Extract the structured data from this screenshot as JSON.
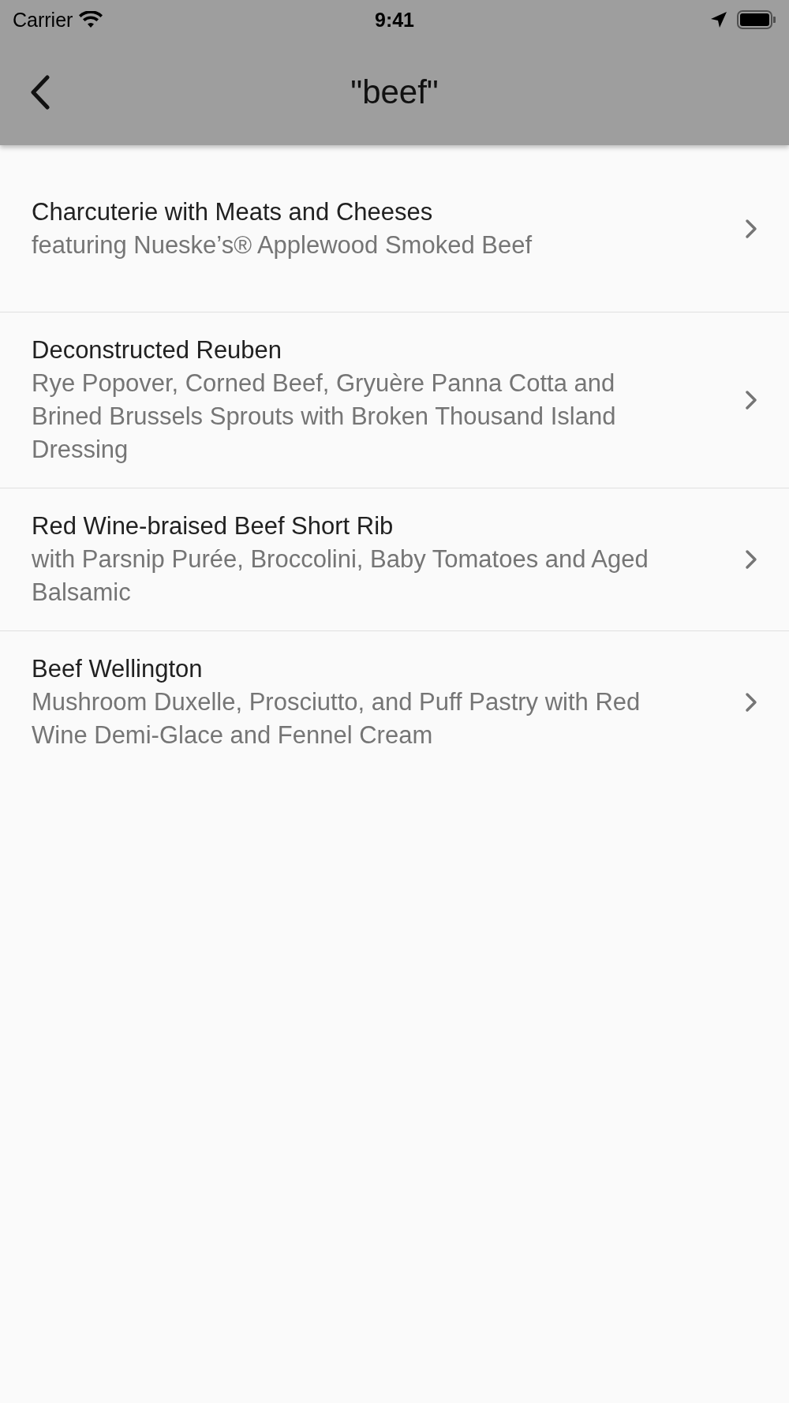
{
  "status_bar": {
    "carrier": "Carrier",
    "time": "9:41"
  },
  "nav_bar": {
    "title": "\"beef\""
  },
  "results": [
    {
      "title": "Charcuterie with Meats and Cheeses",
      "subtitle": "featuring Nueske’s® Applewood Smoked Beef"
    },
    {
      "title": "Deconstructed Reuben",
      "subtitle": "Rye Popover, Corned Beef, Gryuère Panna Cotta and Brined Brussels Sprouts with Broken Thousand Island Dressing"
    },
    {
      "title": "Red Wine-braised Beef Short Rib",
      "subtitle": "with Parsnip Purée, Broccolini, Baby Tomatoes and Aged Balsamic"
    },
    {
      "title": "Beef Wellington",
      "subtitle": "Mushroom Duxelle, Prosciutto, and Puff Pastry with Red Wine Demi-Glace and Fennel Cream"
    }
  ]
}
